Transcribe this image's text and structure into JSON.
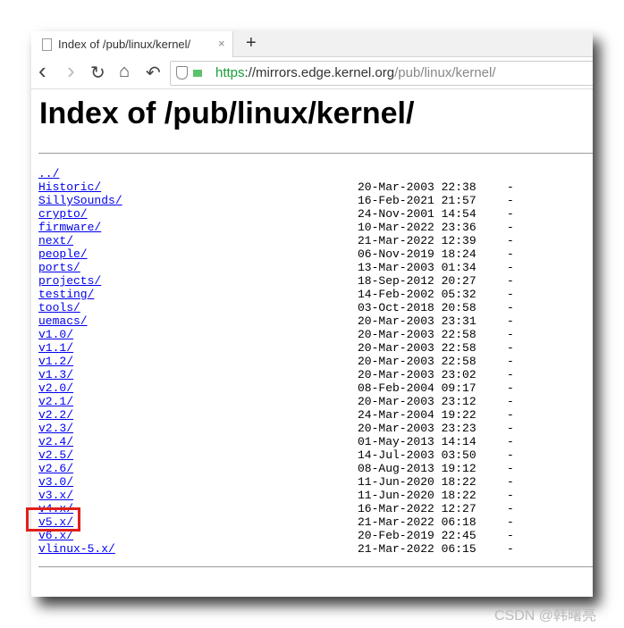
{
  "tab": {
    "title": "Index of /pub/linux/kernel/",
    "close": "×",
    "new_tab": "+"
  },
  "nav": {
    "back": "‹",
    "forward": "›",
    "reload": "↻",
    "home": "⌂",
    "undo": "↶"
  },
  "url": {
    "scheme": "https",
    "host": "://mirrors.edge.kernel.org",
    "path": "/pub/linux/kernel/"
  },
  "heading": "Index of /pub/linux/kernel/",
  "entries": [
    {
      "name": "../",
      "date": "",
      "size": ""
    },
    {
      "name": "Historic/",
      "date": "20-Mar-2003 22:38",
      "size": "-"
    },
    {
      "name": "SillySounds/",
      "date": "16-Feb-2021 21:57",
      "size": "-"
    },
    {
      "name": "crypto/",
      "date": "24-Nov-2001 14:54",
      "size": "-"
    },
    {
      "name": "firmware/",
      "date": "10-Mar-2022 23:36",
      "size": "-"
    },
    {
      "name": "next/",
      "date": "21-Mar-2022 12:39",
      "size": "-"
    },
    {
      "name": "people/",
      "date": "06-Nov-2019 18:24",
      "size": "-"
    },
    {
      "name": "ports/",
      "date": "13-Mar-2003 01:34",
      "size": "-"
    },
    {
      "name": "projects/",
      "date": "18-Sep-2012 20:27",
      "size": "-"
    },
    {
      "name": "testing/",
      "date": "14-Feb-2002 05:32",
      "size": "-"
    },
    {
      "name": "tools/",
      "date": "03-Oct-2018 20:58",
      "size": "-"
    },
    {
      "name": "uemacs/",
      "date": "20-Mar-2003 23:31",
      "size": "-"
    },
    {
      "name": "v1.0/",
      "date": "20-Mar-2003 22:58",
      "size": "-"
    },
    {
      "name": "v1.1/",
      "date": "20-Mar-2003 22:58",
      "size": "-"
    },
    {
      "name": "v1.2/",
      "date": "20-Mar-2003 22:58",
      "size": "-"
    },
    {
      "name": "v1.3/",
      "date": "20-Mar-2003 23:02",
      "size": "-"
    },
    {
      "name": "v2.0/",
      "date": "08-Feb-2004 09:17",
      "size": "-"
    },
    {
      "name": "v2.1/",
      "date": "20-Mar-2003 23:12",
      "size": "-"
    },
    {
      "name": "v2.2/",
      "date": "24-Mar-2004 19:22",
      "size": "-"
    },
    {
      "name": "v2.3/",
      "date": "20-Mar-2003 23:23",
      "size": "-"
    },
    {
      "name": "v2.4/",
      "date": "01-May-2013 14:14",
      "size": "-"
    },
    {
      "name": "v2.5/",
      "date": "14-Jul-2003 03:50",
      "size": "-"
    },
    {
      "name": "v2.6/",
      "date": "08-Aug-2013 19:12",
      "size": "-"
    },
    {
      "name": "v3.0/",
      "date": "11-Jun-2020 18:22",
      "size": "-"
    },
    {
      "name": "v3.x/",
      "date": "11-Jun-2020 18:22",
      "size": "-"
    },
    {
      "name": "v4.x/",
      "date": "16-Mar-2022 12:27",
      "size": "-"
    },
    {
      "name": "v5.x/",
      "date": "21-Mar-2022 06:18",
      "size": "-"
    },
    {
      "name": "v6.x/",
      "date": "20-Feb-2019 22:45",
      "size": "-"
    },
    {
      "name": "vlinux-5.x/",
      "date": "21-Mar-2022 06:15",
      "size": "-"
    }
  ],
  "watermark": "CSDN @韩曙亮",
  "colors": {
    "link": "#0000ee",
    "highlight": "#e0201a"
  }
}
